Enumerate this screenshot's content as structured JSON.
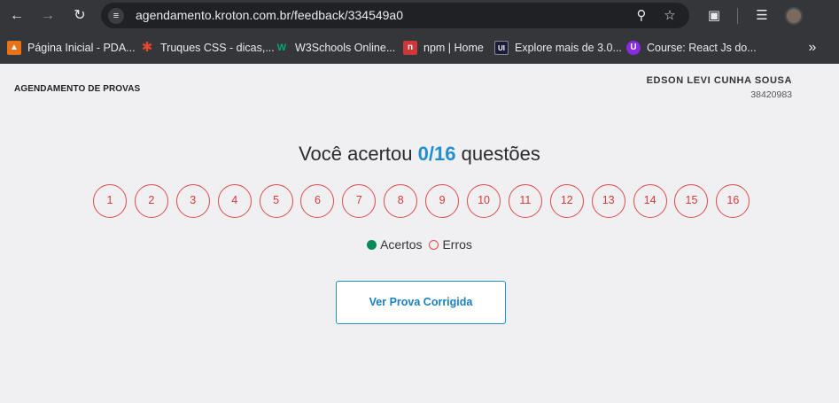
{
  "browser": {
    "url_host": "agendamento.kroton.com.br",
    "url_path": "/feedback/334549a0",
    "bookmarks": [
      {
        "label": "Página Inicial - PDA...",
        "icon": "triangle-icon",
        "color": "#e8711c"
      },
      {
        "label": "Truques CSS - dicas,...",
        "icon": "asterisk-icon",
        "color": "#e8452c"
      },
      {
        "label": "W3Schools Online...",
        "icon": "w3-icon",
        "color": "#04aa6d"
      },
      {
        "label": "npm | Home",
        "icon": "npm-icon",
        "color": "#cb3837"
      },
      {
        "label": "Explore mais de 3.0...",
        "icon": "ui-icon",
        "color": "#1b1b3a"
      },
      {
        "label": "Course: React Js do...",
        "icon": "course-icon",
        "color": "#8a2be2"
      }
    ]
  },
  "header": {
    "brand": "AGENDAMENTO DE PROVAS",
    "user_name": "EDSON LEVI CUNHA SOUSA",
    "user_id": "38420983"
  },
  "result": {
    "prefix": "Você acertou",
    "score": "0/16",
    "suffix": "questões"
  },
  "questions": [
    "1",
    "2",
    "3",
    "4",
    "5",
    "6",
    "7",
    "8",
    "9",
    "10",
    "11",
    "12",
    "13",
    "14",
    "15",
    "16"
  ],
  "legend": {
    "correct": "Acertos",
    "wrong": "Erros",
    "correct_color": "#0a8a5a",
    "wrong_color": "#e04a4a"
  },
  "actions": {
    "view_button": "Ver Prova Corrigida"
  }
}
